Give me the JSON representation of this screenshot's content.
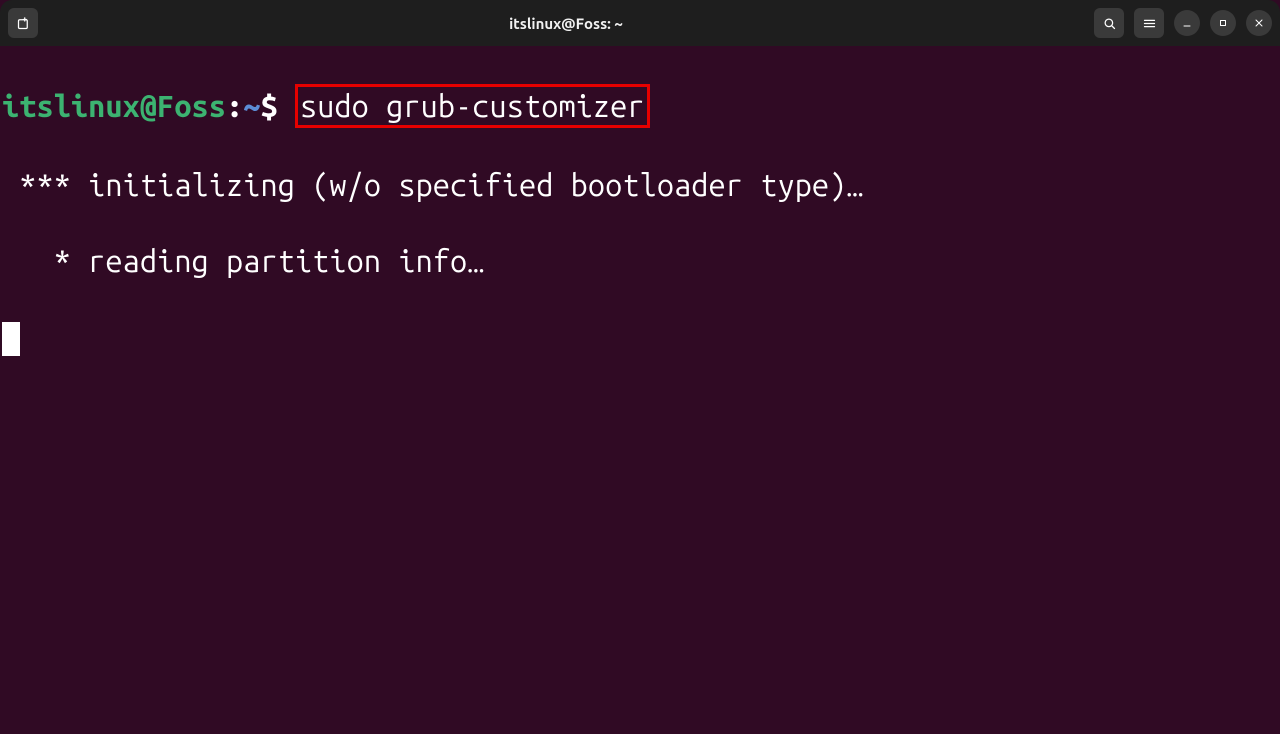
{
  "titlebar": {
    "title": "itslinux@Foss: ~"
  },
  "prompt": {
    "user_host": "itslinux@Foss",
    "sep": ":",
    "path": "~",
    "symbol": "$"
  },
  "command": "sudo grub-customizer",
  "output": {
    "line1": " *** initializing (w/o specified bootloader type)…",
    "line2": "   * reading partition info…"
  },
  "icons": {
    "new_tab": "new-tab-icon",
    "search": "search-icon",
    "menu": "hamburger-icon",
    "minimize": "minimize-icon",
    "maximize": "maximize-icon",
    "close": "close-icon"
  }
}
